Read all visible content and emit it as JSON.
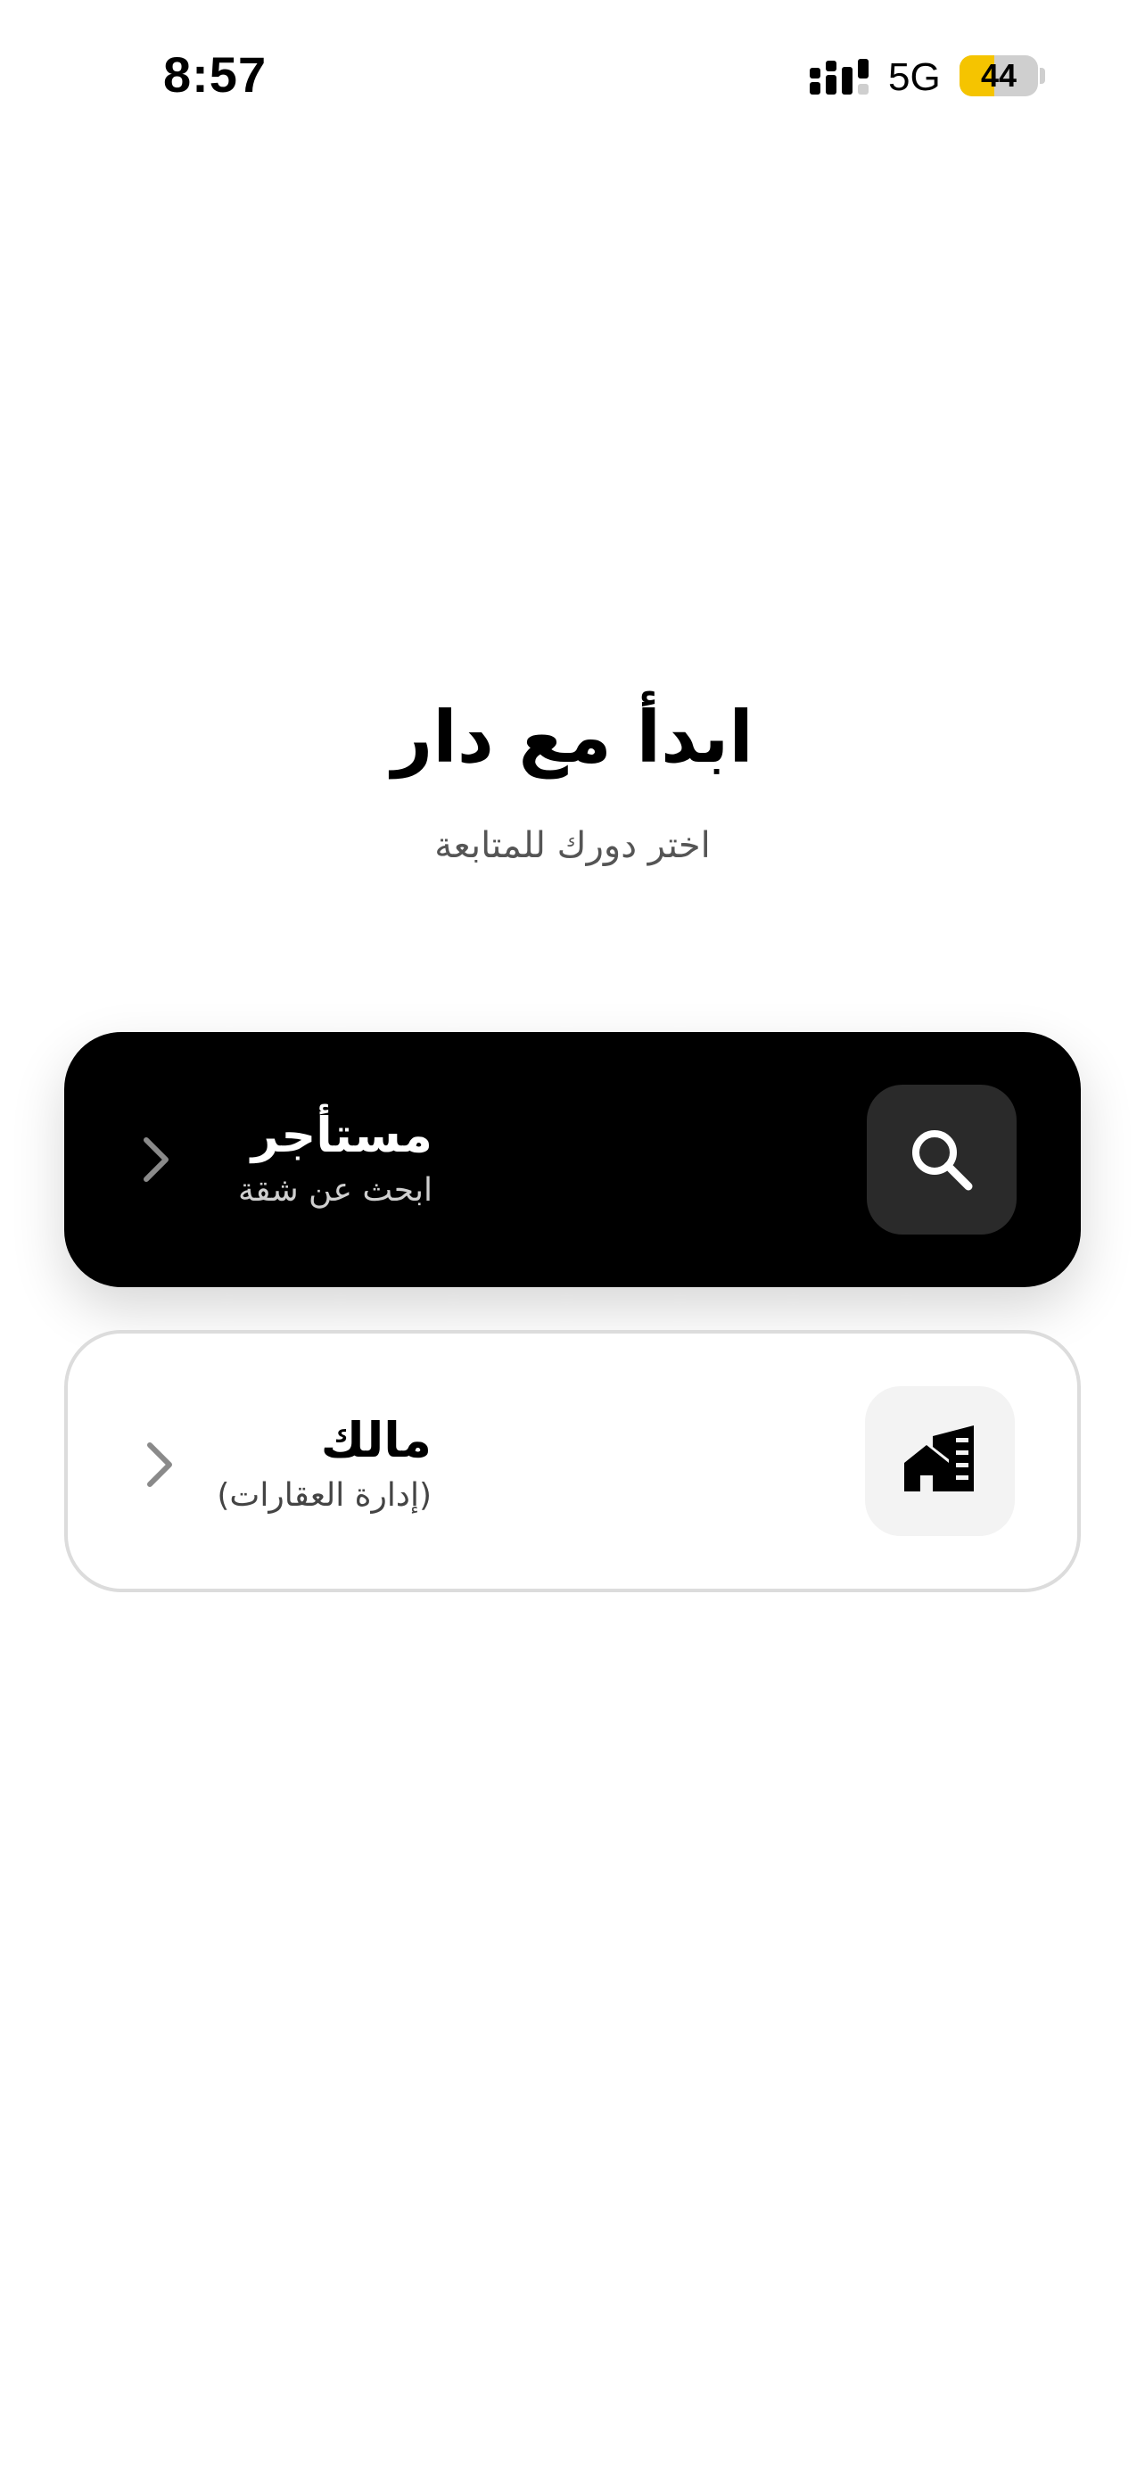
{
  "status_bar": {
    "time": "8:57",
    "network": "5G",
    "battery_level": "44",
    "battery_fill_fraction": 0.44
  },
  "heading": {
    "title": "ابدأ مع دار",
    "subtitle": "اختر دورك للمتابعة"
  },
  "roles": [
    {
      "title": "مستأجر",
      "subtitle": "ابحث عن شقة",
      "icon": "search-icon",
      "selected": true
    },
    {
      "title": "مالك",
      "subtitle": "(إدارة العقارات)",
      "icon": "buildings-icon",
      "selected": false
    }
  ],
  "colors": {
    "selected_card_bg": "#000000",
    "card_border": "#dcdcdc",
    "battery_accent": "#f5c400"
  }
}
